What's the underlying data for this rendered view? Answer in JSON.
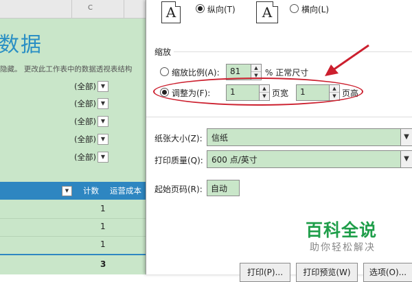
{
  "sheet": {
    "column_header": "C",
    "title": "数据",
    "note": "隐藏。 更改此工作表中的数据透视表结构",
    "filters": [
      "(全部)",
      "(全部)",
      "(全部)",
      "(全部)",
      "(全部)"
    ],
    "pivot_headers": [
      "计数",
      "运营成本"
    ],
    "rows": [
      "1",
      "1",
      "1"
    ],
    "total": "3"
  },
  "dialog": {
    "orientation": {
      "portrait_label": "纵向(T)",
      "landscape_label": "横向(L)",
      "icon_letter": "A",
      "selected": "portrait"
    },
    "scaling": {
      "title": "缩放",
      "adjust_label": "缩放比例(A):",
      "adjust_value": "81",
      "adjust_suffix": "% 正常尺寸",
      "fit_label": "调整为(F):",
      "fit_wide_value": "1",
      "fit_wide_suffix": "页宽",
      "fit_tall_value": "1",
      "fit_tall_suffix": "页高",
      "selected": "fit"
    },
    "paper_size_label": "纸张大小(Z):",
    "paper_size_value": "信纸",
    "print_quality_label": "打印质量(Q):",
    "print_quality_value": "600 点/英寸",
    "first_page_label": "起始页码(R):",
    "first_page_value": "自动",
    "buttons": {
      "print": "打印(P)...",
      "print_preview": "打印预览(W)",
      "options": "选项(O)..."
    }
  },
  "watermark": {
    "title": "百科全说",
    "subtitle": "助你轻松解决"
  },
  "colors": {
    "field_green": "#c9e6c9",
    "pivot_blue": "#2e86c1",
    "title_blue": "#2a8fc4",
    "annotation_red": "#cc1f2e",
    "watermark_green": "#1f9e4a"
  }
}
